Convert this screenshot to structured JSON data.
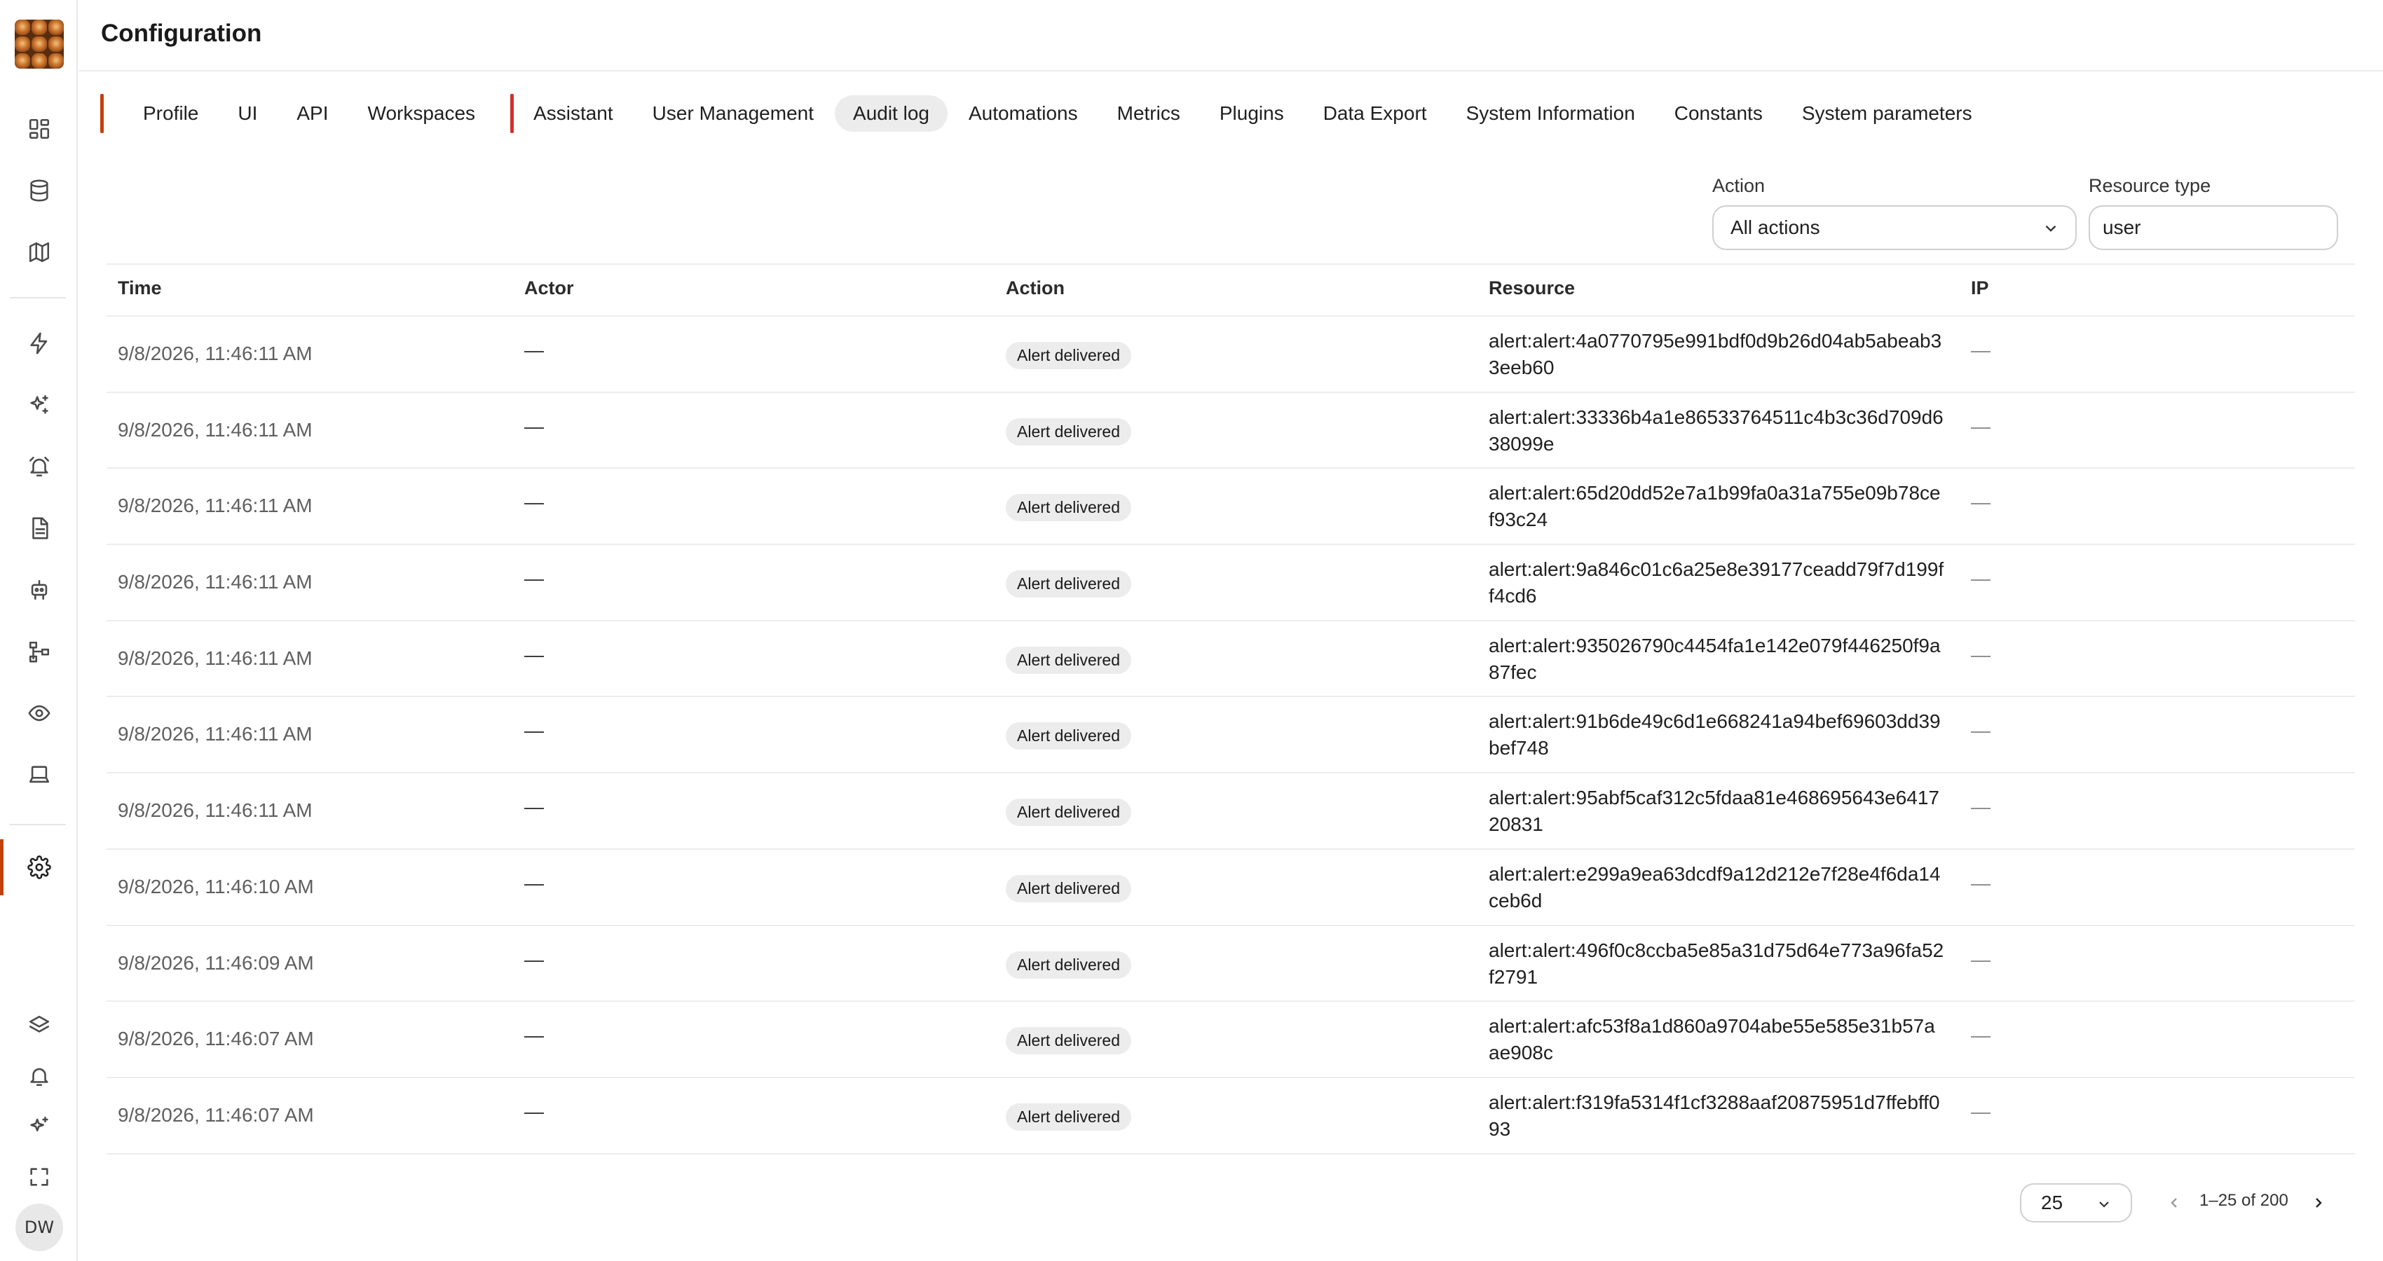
{
  "app": {
    "title": "Configuration",
    "avatar_initials": "DW"
  },
  "sidebar": {
    "top_icons": [
      "dashboard-icon",
      "database-icon",
      "map-icon"
    ],
    "middle_icons": [
      "lightning-icon",
      "sparkles-icon",
      "alarm-icon",
      "document-icon",
      "robot-icon",
      "hierarchy-icon",
      "eye-icon",
      "laptop-icon",
      "gear-icon"
    ],
    "bottom_icons": [
      "layers-icon",
      "bell-icon",
      "sparkles-small-icon",
      "fullscreen-icon"
    ],
    "active": "gear-icon",
    "accent_color": "#c2410c"
  },
  "tabs": [
    {
      "label": "Profile"
    },
    {
      "label": "UI"
    },
    {
      "label": "API"
    },
    {
      "label": "Workspaces"
    },
    {
      "label": "Assistant"
    },
    {
      "label": "User Management"
    },
    {
      "label": "Audit log",
      "active": true
    },
    {
      "label": "Automations"
    },
    {
      "label": "Metrics"
    },
    {
      "label": "Plugins"
    },
    {
      "label": "Data Export"
    },
    {
      "label": "System Information"
    },
    {
      "label": "Constants"
    },
    {
      "label": "System parameters"
    }
  ],
  "filters": {
    "action_label": "Action",
    "action_value": "All actions",
    "resource_type_label": "Resource type",
    "resource_type_value": "user"
  },
  "table": {
    "columns": [
      "Time",
      "Actor",
      "Action",
      "Resource",
      "IP"
    ],
    "rows": [
      {
        "time": "9/8/2026, 11:46:11 AM",
        "actor": "—",
        "action": "Alert delivered",
        "resource": "alert:alert:4a0770795e991bdf0d9b26d04ab5abeab33eeb60",
        "ip": "—"
      },
      {
        "time": "9/8/2026, 11:46:11 AM",
        "actor": "—",
        "action": "Alert delivered",
        "resource": "alert:alert:33336b4a1e86533764511c4b3c36d709d638099e",
        "ip": "—"
      },
      {
        "time": "9/8/2026, 11:46:11 AM",
        "actor": "—",
        "action": "Alert delivered",
        "resource": "alert:alert:65d20dd52e7a1b99fa0a31a755e09b78cef93c24",
        "ip": "—"
      },
      {
        "time": "9/8/2026, 11:46:11 AM",
        "actor": "—",
        "action": "Alert delivered",
        "resource": "alert:alert:9a846c01c6a25e8e39177ceadd79f7d199ff4cd6",
        "ip": "—"
      },
      {
        "time": "9/8/2026, 11:46:11 AM",
        "actor": "—",
        "action": "Alert delivered",
        "resource": "alert:alert:935026790c4454fa1e142e079f446250f9a87fec",
        "ip": "—"
      },
      {
        "time": "9/8/2026, 11:46:11 AM",
        "actor": "—",
        "action": "Alert delivered",
        "resource": "alert:alert:91b6de49c6d1e668241a94bef69603dd39bef748",
        "ip": "—"
      },
      {
        "time": "9/8/2026, 11:46:11 AM",
        "actor": "—",
        "action": "Alert delivered",
        "resource": "alert:alert:95abf5caf312c5fdaa81e468695643e641720831",
        "ip": "—"
      },
      {
        "time": "9/8/2026, 11:46:10 AM",
        "actor": "—",
        "action": "Alert delivered",
        "resource": "alert:alert:e299a9ea63dcdf9a12d212e7f28e4f6da14ceb6d",
        "ip": "—"
      },
      {
        "time": "9/8/2026, 11:46:09 AM",
        "actor": "—",
        "action": "Alert delivered",
        "resource": "alert:alert:496f0c8ccba5e85a31d75d64e773a96fa52f2791",
        "ip": "—"
      },
      {
        "time": "9/8/2026, 11:46:07 AM",
        "actor": "—",
        "action": "Alert delivered",
        "resource": "alert:alert:afc53f8a1d860a9704abe55e585e31b57aae908c",
        "ip": "—"
      },
      {
        "time": "9/8/2026, 11:46:07 AM",
        "actor": "—",
        "action": "Alert delivered",
        "resource": "alert:alert:f319fa5314f1cf3288aaf20875951d7ffebff093",
        "ip": "—"
      }
    ]
  },
  "pagination": {
    "page_size": "25",
    "range_text": "1–25 of 200"
  }
}
